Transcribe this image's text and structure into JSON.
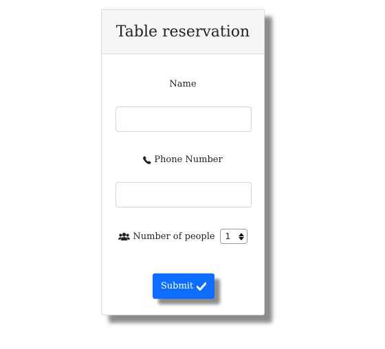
{
  "form": {
    "title": "Table reservation",
    "name_label": "Name",
    "name_value": "",
    "phone_label": "Phone Number",
    "phone_value": "",
    "people_label": "Number of people",
    "people_selected": "1",
    "submit_label": "Submit"
  },
  "icons": {
    "phone": "phone-icon",
    "people": "users-icon",
    "submit": "check-icon"
  },
  "colors": {
    "accent": "#0d6efd",
    "header_bg": "#f6f6f6"
  }
}
